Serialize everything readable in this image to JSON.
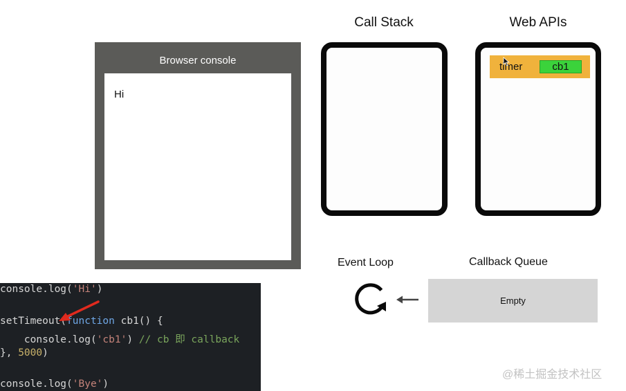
{
  "console": {
    "title": "Browser console",
    "lines": [
      "Hi"
    ]
  },
  "call_stack": {
    "title": "Call Stack"
  },
  "web_apis": {
    "title": "Web APIs",
    "timer_label": "timer",
    "callback_label": "cb1"
  },
  "event_loop": {
    "title": "Event Loop"
  },
  "callback_queue": {
    "title": "Callback Queue",
    "status": "Empty"
  },
  "code": {
    "line1": {
      "fn": "console.log(",
      "arg": "'Hi'",
      "end": ")"
    },
    "line2": {
      "fn": "setTimeout(",
      "kw": "function",
      "rest": " cb1() {"
    },
    "line3": {
      "indent": "    ",
      "fn": "console.log(",
      "arg": "'cb1'",
      "end": ") ",
      "comment": "// cb 即 callback"
    },
    "line4": {
      "start": "}, ",
      "num": "5000",
      "end": ")"
    },
    "line5": {
      "fn": "console.log(",
      "arg": "'Bye'",
      "end": ")"
    }
  },
  "watermark": "@稀土掘金技术社区",
  "colors": {
    "console_frame": "#5b5b58",
    "frame_border": "#0a0a0a",
    "timer_block": "#f0b23c",
    "callback_block": "#3bd33b",
    "queue_box": "#d5d5d5",
    "code_bg": "#1d2024",
    "arrow_red": "#e02a1e"
  },
  "icons": {
    "event_loop": "refresh-cycle-icon",
    "queue_to_loop": "arrow-left-icon",
    "pointer": "mouse-cursor-icon",
    "annotation": "red-arrow-icon"
  }
}
